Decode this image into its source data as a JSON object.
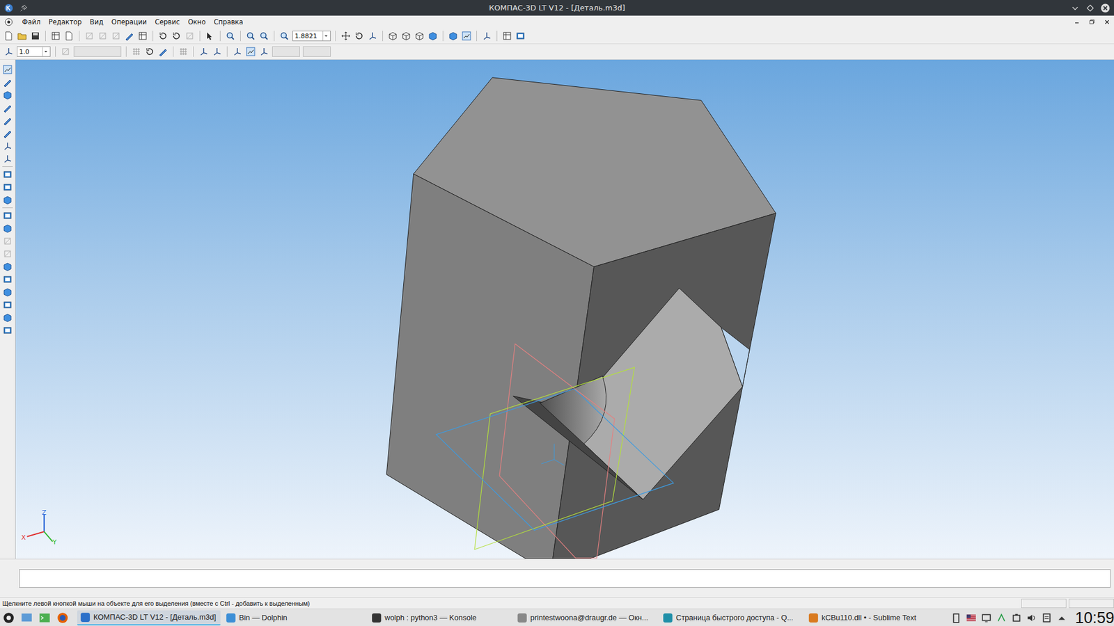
{
  "window": {
    "title": "КОМПАС-3D LT V12 - [Деталь.m3d]"
  },
  "menu": [
    {
      "label": "Файл"
    },
    {
      "label": "Редактор"
    },
    {
      "label": "Вид"
    },
    {
      "label": "Операции"
    },
    {
      "label": "Сервис"
    },
    {
      "label": "Окно"
    },
    {
      "label": "Справка"
    }
  ],
  "toolbar": {
    "zoom": "1.8821",
    "step": "1.0"
  },
  "axes": {
    "z": "Z",
    "x": "X",
    "y": "Y"
  },
  "status_bar": "Щелкните левой кнопкой мыши на объекте для его выделения (вместе с Ctrl - добавить к выделенным)",
  "taskbar": {
    "items": [
      {
        "label": "КОМПАС-3D LT V12 - [Деталь.m3d]",
        "selected": true,
        "color": "#2a6fc9"
      },
      {
        "label": "Bin — Dolphin",
        "selected": false,
        "color": "#3d8fd6"
      },
      {
        "label": "wolph : python3 — Konsole",
        "selected": false,
        "color": "#333333"
      },
      {
        "label": "printestwoona@draugr.de — Окн...",
        "selected": false,
        "color": "#888888"
      },
      {
        "label": "Страница быстрого доступа - Q...",
        "selected": false,
        "color": "#1f8fa8"
      },
      {
        "label": "kCBu110.dll • - Sublime Text",
        "selected": false,
        "color": "#d97a1f"
      }
    ],
    "clock": "10:59"
  }
}
